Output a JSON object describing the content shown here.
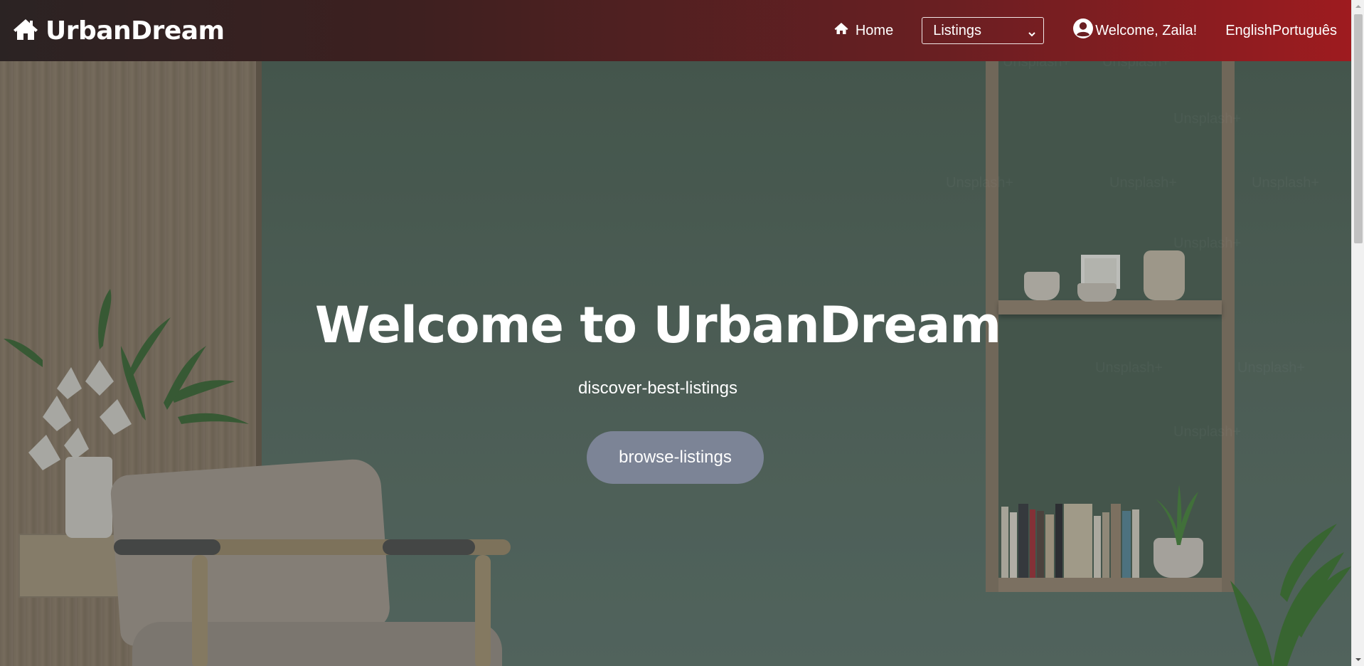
{
  "navbar": {
    "brand": {
      "icon": "house-icon",
      "text": "UrbanDream"
    },
    "home": {
      "icon": "house-icon",
      "label": "Home"
    },
    "listings_select": {
      "value": "Listings",
      "icon": "chevron-down-icon"
    },
    "user": {
      "icon": "user-circle-icon",
      "label": "Welcome, Zaila!"
    },
    "languages": [
      "English",
      "Português"
    ]
  },
  "hero": {
    "title": "Welcome to UrbanDream",
    "subtitle": "discover-best-listings",
    "button_label": "browse-listings",
    "watermark_text": "Unsplash+"
  },
  "colors": {
    "navbar_start": "#2b2323",
    "navbar_end": "#9e1b1f",
    "button_bg": "#7c8496",
    "wall_green": "#5a6f65"
  }
}
